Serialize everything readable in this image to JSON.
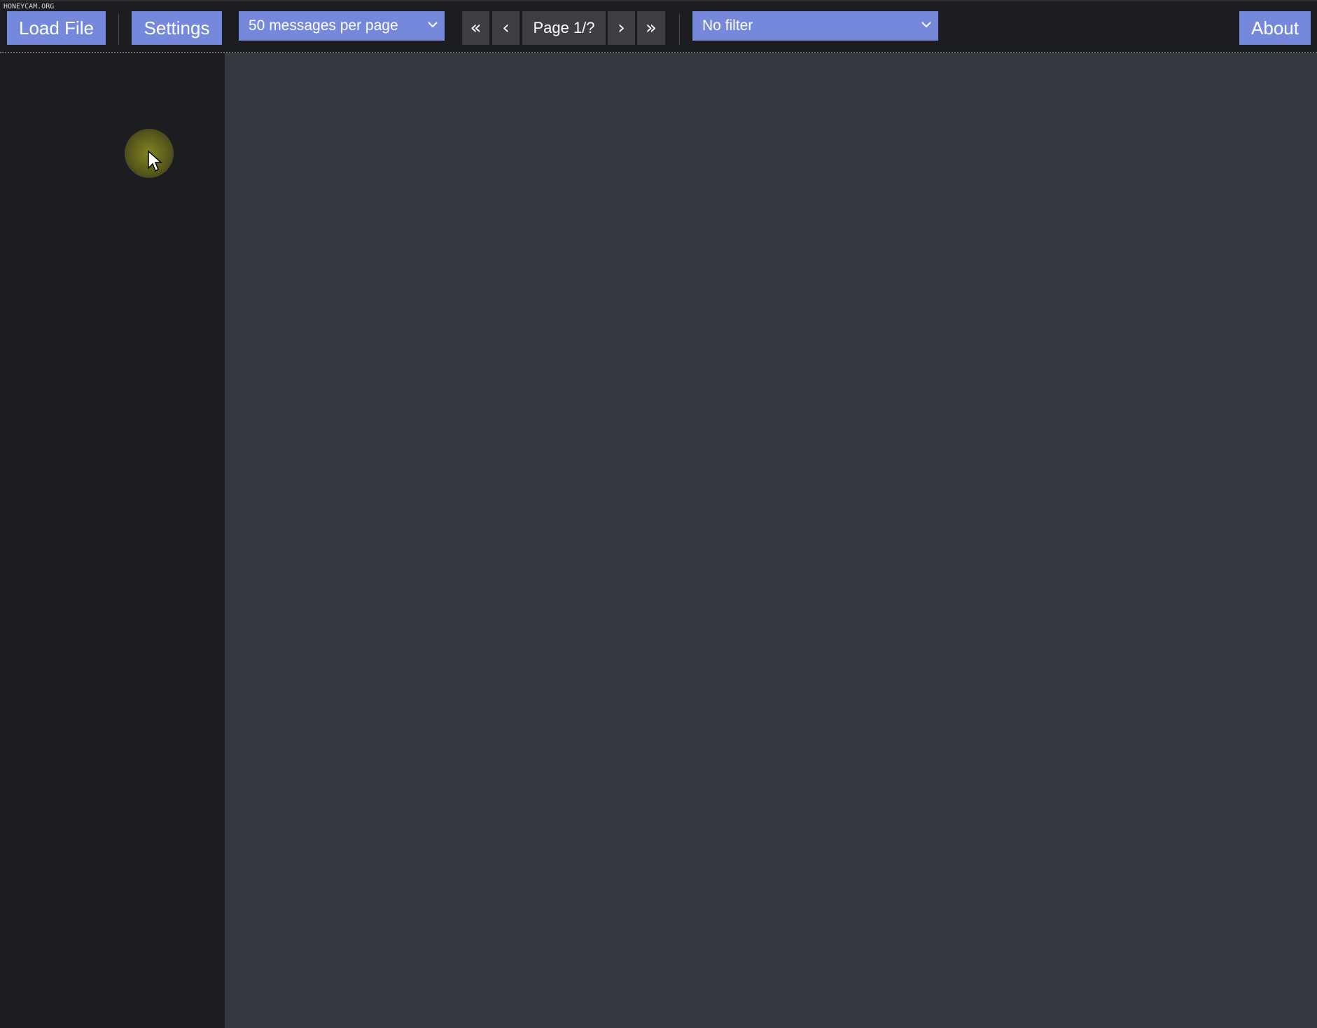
{
  "watermark": "HONEYCAM.ORG",
  "toolbar": {
    "load_file_label": "Load File",
    "settings_label": "Settings",
    "per_page_select": {
      "selected": "50 messages per page"
    },
    "pager": {
      "first_label": "«",
      "prev_label": "‹",
      "page_label": "Page 1/?",
      "next_label": "›",
      "last_label": "»"
    },
    "filter_select": {
      "selected": "No filter"
    },
    "about_label": "About"
  },
  "colors": {
    "accent": "#7588dc",
    "toolbar_bg": "#1b1d21",
    "content_bg": "#35383e",
    "pager_bg": "#3d3f44"
  },
  "icons": {
    "select_chevron": "chevron-down-icon",
    "cursor": "mouse-pointer-icon"
  }
}
